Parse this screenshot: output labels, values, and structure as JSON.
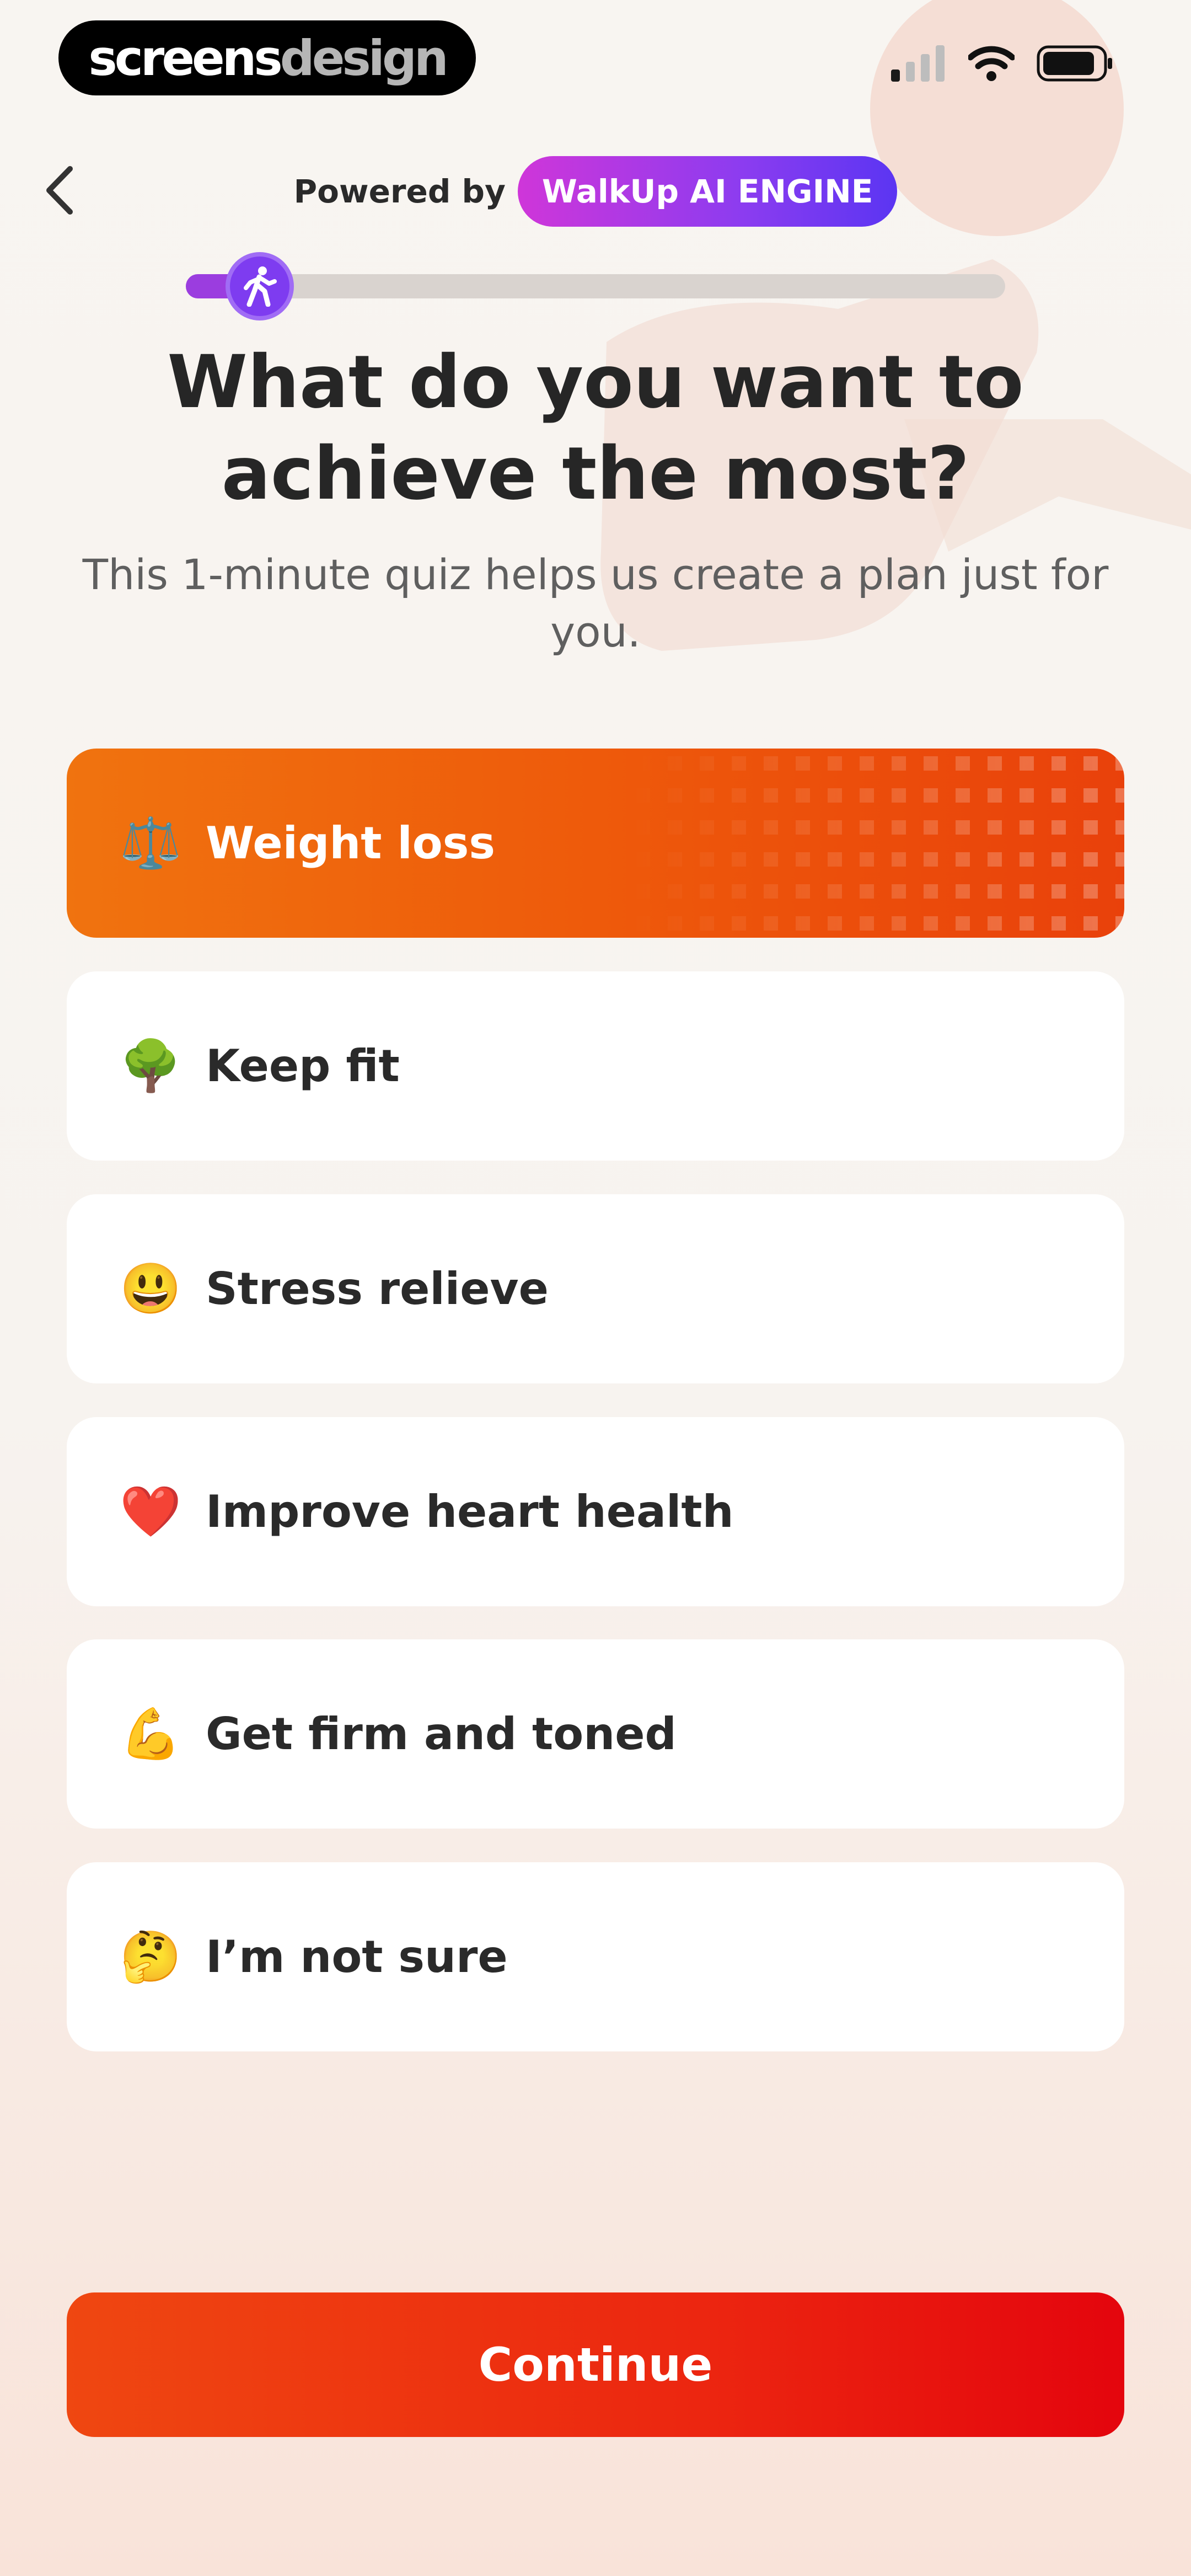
{
  "brand": {
    "part_a": "screens",
    "part_b": "design"
  },
  "status_bar": {
    "signal_icon": "signal-bars-icon",
    "wifi_icon": "wifi-icon",
    "battery_icon": "battery-icon"
  },
  "header": {
    "back_icon": "chevron-left-icon",
    "powered_label": "Powered by",
    "engine_label": "WalkUp AI ENGINE"
  },
  "progress": {
    "fraction": 0.09,
    "knob_icon": "walking-person-icon"
  },
  "question": {
    "title": "What do you want to achieve the most?",
    "subtitle": "This 1-minute quiz helps us create a plan just for you."
  },
  "options": [
    {
      "emoji": "⚖️",
      "label": "Weight loss",
      "selected": true
    },
    {
      "emoji": "🌳",
      "label": "Keep fit",
      "selected": false
    },
    {
      "emoji": "😃",
      "label": "Stress relieve",
      "selected": false
    },
    {
      "emoji": "❤️",
      "label": "Improve heart health",
      "selected": false
    },
    {
      "emoji": "💪",
      "label": "Get firm and toned",
      "selected": false
    },
    {
      "emoji": "🤔",
      "label": "I’m not sure",
      "selected": false
    }
  ],
  "footer": {
    "continue_label": "Continue"
  },
  "colors": {
    "accent_orange": "#ee5a0b",
    "continue_red": "#e4050d",
    "engine_purple": "#8b3cf0"
  }
}
